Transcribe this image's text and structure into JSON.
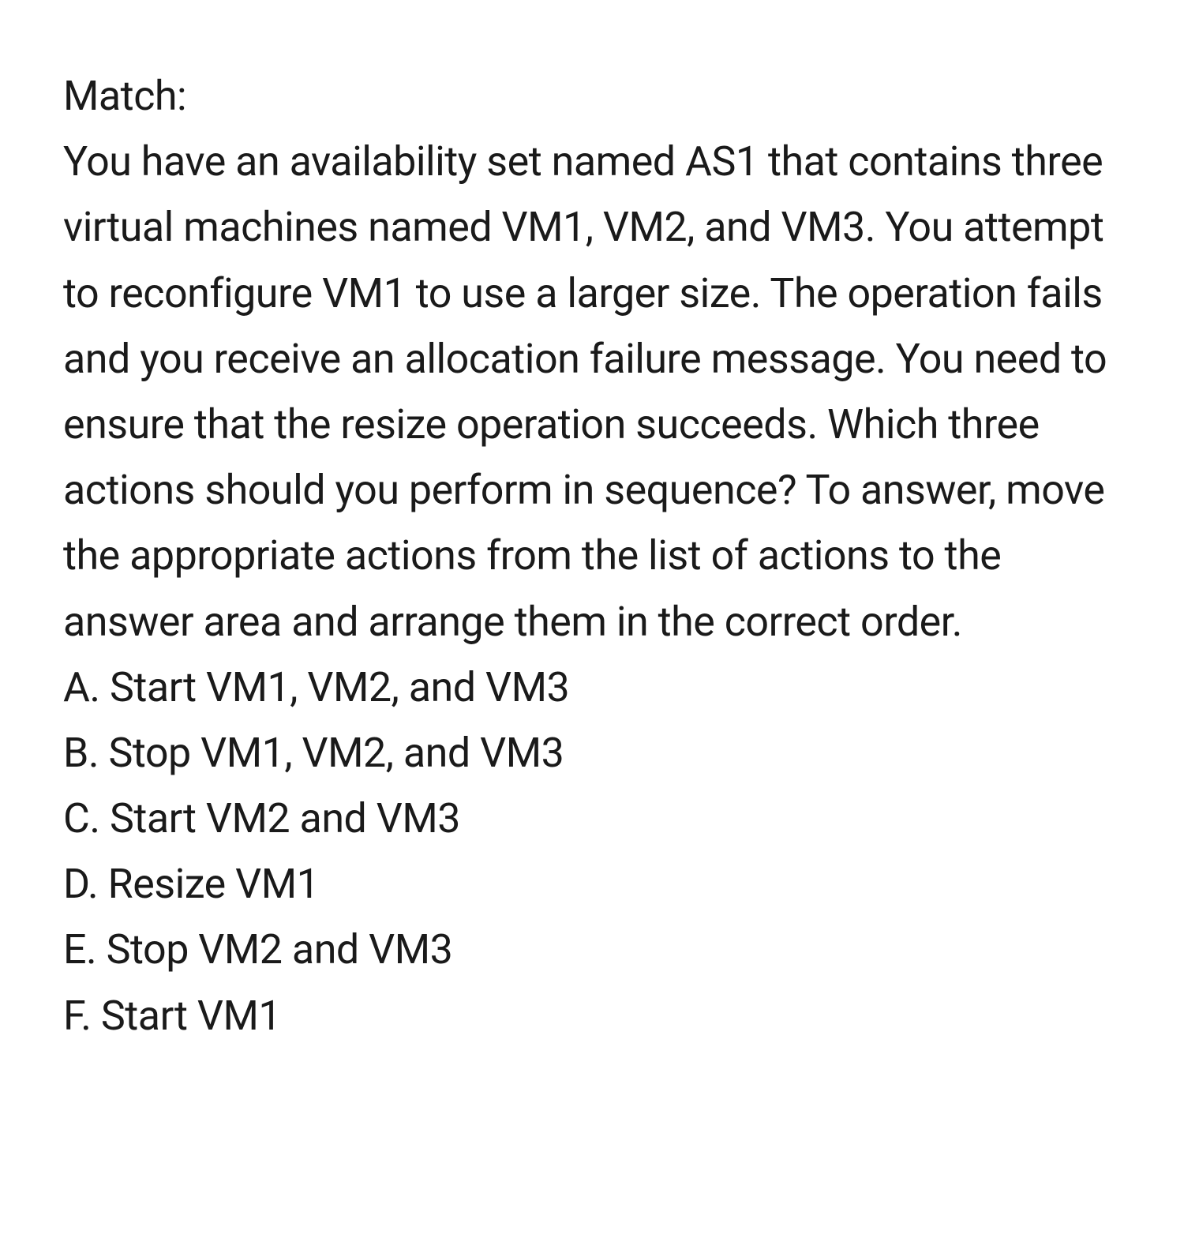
{
  "heading": "Match:",
  "question_body": "You have an availability set named AS1 that contains three virtual machines named VM1, VM2, and VM3. You attempt to reconfigure VM1 to use a larger size. The operation fails and you receive an allocation failure message. You need to ensure that the resize operation succeeds. Which three actions should you perform in sequence? To answer, move the appropriate actions from the list of actions to the answer area and arrange them in the correct order.",
  "options": [
    "A. Start VM1, VM2, and VM3",
    "B. Stop VM1, VM2, and VM3",
    "C. Start VM2 and VM3",
    "D. Resize VM1",
    "E. Stop VM2 and VM3",
    "F. Start VM1"
  ]
}
